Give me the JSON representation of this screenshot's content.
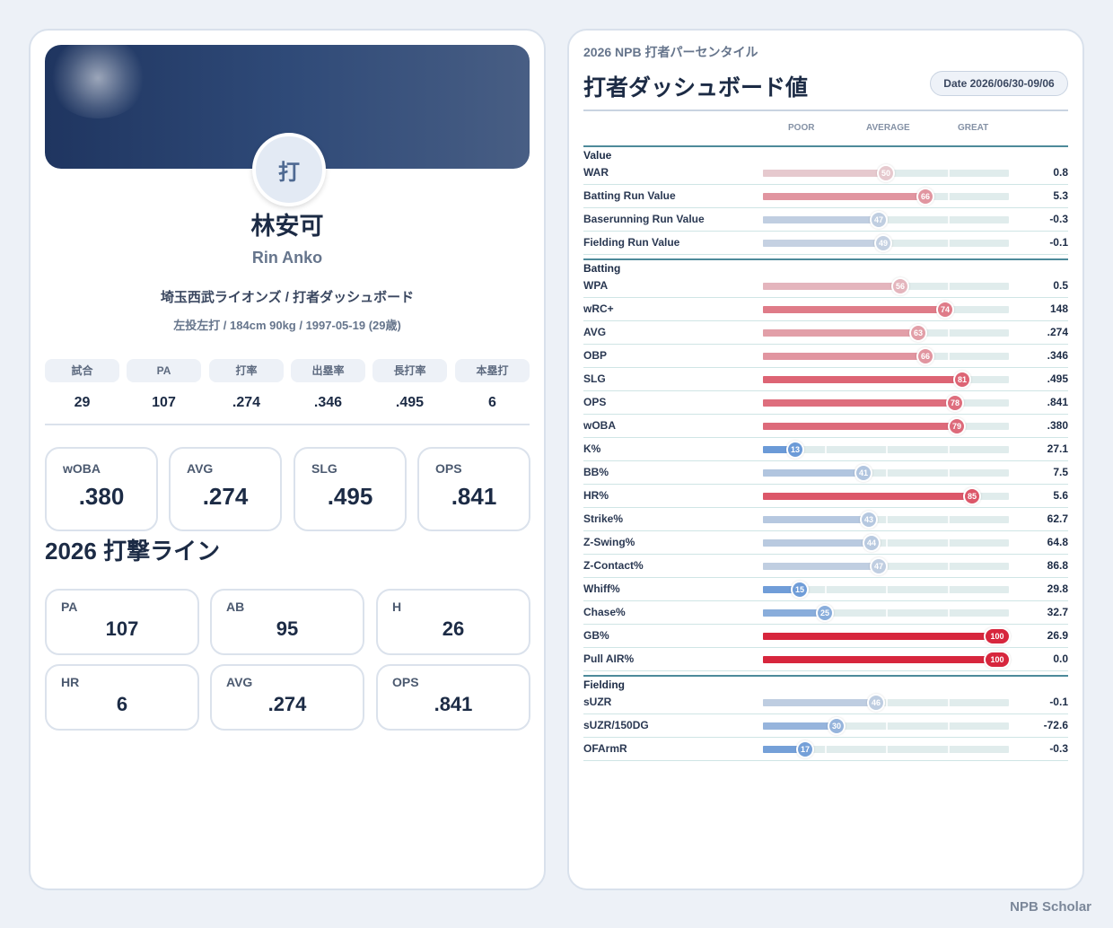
{
  "player": {
    "avatar_text": "打",
    "name_ja": "林安可",
    "name_en": "Rin Anko",
    "team_line": "埼玉西武ライオンズ / 打者ダッシュボード",
    "bio_line": "左投左打 / 184cm 90kg / 1997-05-19 (29歳)"
  },
  "summary": [
    {
      "label": "試合",
      "value": "29"
    },
    {
      "label": "PA",
      "value": "107"
    },
    {
      "label": "打率",
      "value": ".274"
    },
    {
      "label": "出塁率",
      "value": ".346"
    },
    {
      "label": "長打率",
      "value": ".495"
    },
    {
      "label": "本塁打",
      "value": "6"
    }
  ],
  "key_stats": [
    {
      "label": "wOBA",
      "value": ".380"
    },
    {
      "label": "AVG",
      "value": ".274"
    },
    {
      "label": "SLG",
      "value": ".495"
    },
    {
      "label": "OPS",
      "value": ".841"
    }
  ],
  "batting_line": {
    "title": "2026 打撃ライン",
    "items": [
      {
        "label": "PA",
        "value": "107"
      },
      {
        "label": "AB",
        "value": "95"
      },
      {
        "label": "H",
        "value": "26"
      },
      {
        "label": "HR",
        "value": "6"
      },
      {
        "label": "AVG",
        "value": ".274"
      },
      {
        "label": "OPS",
        "value": ".841"
      }
    ]
  },
  "dashboard": {
    "subtitle": "2026 NPB 打者パーセンタイル",
    "title": "打者ダッシュボード値",
    "date": "Date 2026/06/30-09/06",
    "scale": {
      "poor": "POOR",
      "average": "AVERAGE",
      "great": "GREAT"
    },
    "sections": [
      {
        "name": "Value",
        "rows": [
          {
            "label": "WAR",
            "pct": 50,
            "value": "0.8"
          },
          {
            "label": "Batting Run Value",
            "pct": 66,
            "value": "5.3"
          },
          {
            "label": "Baserunning Run Value",
            "pct": 47,
            "value": "-0.3"
          },
          {
            "label": "Fielding Run Value",
            "pct": 49,
            "value": "-0.1"
          }
        ]
      },
      {
        "name": "Batting",
        "rows": [
          {
            "label": "WPA",
            "pct": 56,
            "value": "0.5"
          },
          {
            "label": "wRC+",
            "pct": 74,
            "value": "148"
          },
          {
            "label": "AVG",
            "pct": 63,
            "value": ".274"
          },
          {
            "label": "OBP",
            "pct": 66,
            "value": ".346"
          },
          {
            "label": "SLG",
            "pct": 81,
            "value": ".495"
          },
          {
            "label": "OPS",
            "pct": 78,
            "value": ".841"
          },
          {
            "label": "wOBA",
            "pct": 79,
            "value": ".380"
          },
          {
            "label": "K%",
            "pct": 13,
            "value": "27.1"
          },
          {
            "label": "BB%",
            "pct": 41,
            "value": "7.5"
          },
          {
            "label": "HR%",
            "pct": 85,
            "value": "5.6"
          },
          {
            "label": "Strike%",
            "pct": 43,
            "value": "62.7"
          },
          {
            "label": "Z-Swing%",
            "pct": 44,
            "value": "64.8"
          },
          {
            "label": "Z-Contact%",
            "pct": 47,
            "value": "86.8"
          },
          {
            "label": "Whiff%",
            "pct": 15,
            "value": "29.8"
          },
          {
            "label": "Chase%",
            "pct": 25,
            "value": "32.7"
          },
          {
            "label": "GB%",
            "pct": 100,
            "value": "26.9"
          },
          {
            "label": "Pull AIR%",
            "pct": 100,
            "value": "0.0"
          }
        ]
      },
      {
        "name": "Fielding",
        "rows": [
          {
            "label": "sUZR",
            "pct": 46,
            "value": "-0.1"
          },
          {
            "label": "sUZR/150DG",
            "pct": 30,
            "value": "-72.6"
          },
          {
            "label": "OFArmR",
            "pct": 17,
            "value": "-0.3"
          }
        ]
      }
    ]
  },
  "footer": "NPB Scholar"
}
